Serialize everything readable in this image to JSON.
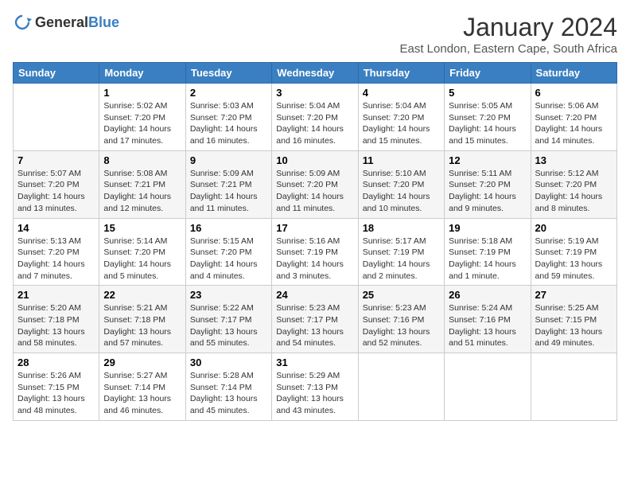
{
  "logo": {
    "general": "General",
    "blue": "Blue"
  },
  "header": {
    "month": "January 2024",
    "location": "East London, Eastern Cape, South Africa"
  },
  "weekdays": [
    "Sunday",
    "Monday",
    "Tuesday",
    "Wednesday",
    "Thursday",
    "Friday",
    "Saturday"
  ],
  "weeks": [
    [
      {
        "day": "",
        "info": ""
      },
      {
        "day": "1",
        "info": "Sunrise: 5:02 AM\nSunset: 7:20 PM\nDaylight: 14 hours\nand 17 minutes."
      },
      {
        "day": "2",
        "info": "Sunrise: 5:03 AM\nSunset: 7:20 PM\nDaylight: 14 hours\nand 16 minutes."
      },
      {
        "day": "3",
        "info": "Sunrise: 5:04 AM\nSunset: 7:20 PM\nDaylight: 14 hours\nand 16 minutes."
      },
      {
        "day": "4",
        "info": "Sunrise: 5:04 AM\nSunset: 7:20 PM\nDaylight: 14 hours\nand 15 minutes."
      },
      {
        "day": "5",
        "info": "Sunrise: 5:05 AM\nSunset: 7:20 PM\nDaylight: 14 hours\nand 15 minutes."
      },
      {
        "day": "6",
        "info": "Sunrise: 5:06 AM\nSunset: 7:20 PM\nDaylight: 14 hours\nand 14 minutes."
      }
    ],
    [
      {
        "day": "7",
        "info": "Sunrise: 5:07 AM\nSunset: 7:20 PM\nDaylight: 14 hours\nand 13 minutes."
      },
      {
        "day": "8",
        "info": "Sunrise: 5:08 AM\nSunset: 7:21 PM\nDaylight: 14 hours\nand 12 minutes."
      },
      {
        "day": "9",
        "info": "Sunrise: 5:09 AM\nSunset: 7:21 PM\nDaylight: 14 hours\nand 11 minutes."
      },
      {
        "day": "10",
        "info": "Sunrise: 5:09 AM\nSunset: 7:20 PM\nDaylight: 14 hours\nand 11 minutes."
      },
      {
        "day": "11",
        "info": "Sunrise: 5:10 AM\nSunset: 7:20 PM\nDaylight: 14 hours\nand 10 minutes."
      },
      {
        "day": "12",
        "info": "Sunrise: 5:11 AM\nSunset: 7:20 PM\nDaylight: 14 hours\nand 9 minutes."
      },
      {
        "day": "13",
        "info": "Sunrise: 5:12 AM\nSunset: 7:20 PM\nDaylight: 14 hours\nand 8 minutes."
      }
    ],
    [
      {
        "day": "14",
        "info": "Sunrise: 5:13 AM\nSunset: 7:20 PM\nDaylight: 14 hours\nand 7 minutes."
      },
      {
        "day": "15",
        "info": "Sunrise: 5:14 AM\nSunset: 7:20 PM\nDaylight: 14 hours\nand 5 minutes."
      },
      {
        "day": "16",
        "info": "Sunrise: 5:15 AM\nSunset: 7:20 PM\nDaylight: 14 hours\nand 4 minutes."
      },
      {
        "day": "17",
        "info": "Sunrise: 5:16 AM\nSunset: 7:19 PM\nDaylight: 14 hours\nand 3 minutes."
      },
      {
        "day": "18",
        "info": "Sunrise: 5:17 AM\nSunset: 7:19 PM\nDaylight: 14 hours\nand 2 minutes."
      },
      {
        "day": "19",
        "info": "Sunrise: 5:18 AM\nSunset: 7:19 PM\nDaylight: 14 hours\nand 1 minute."
      },
      {
        "day": "20",
        "info": "Sunrise: 5:19 AM\nSunset: 7:19 PM\nDaylight: 13 hours\nand 59 minutes."
      }
    ],
    [
      {
        "day": "21",
        "info": "Sunrise: 5:20 AM\nSunset: 7:18 PM\nDaylight: 13 hours\nand 58 minutes."
      },
      {
        "day": "22",
        "info": "Sunrise: 5:21 AM\nSunset: 7:18 PM\nDaylight: 13 hours\nand 57 minutes."
      },
      {
        "day": "23",
        "info": "Sunrise: 5:22 AM\nSunset: 7:17 PM\nDaylight: 13 hours\nand 55 minutes."
      },
      {
        "day": "24",
        "info": "Sunrise: 5:23 AM\nSunset: 7:17 PM\nDaylight: 13 hours\nand 54 minutes."
      },
      {
        "day": "25",
        "info": "Sunrise: 5:23 AM\nSunset: 7:16 PM\nDaylight: 13 hours\nand 52 minutes."
      },
      {
        "day": "26",
        "info": "Sunrise: 5:24 AM\nSunset: 7:16 PM\nDaylight: 13 hours\nand 51 minutes."
      },
      {
        "day": "27",
        "info": "Sunrise: 5:25 AM\nSunset: 7:15 PM\nDaylight: 13 hours\nand 49 minutes."
      }
    ],
    [
      {
        "day": "28",
        "info": "Sunrise: 5:26 AM\nSunset: 7:15 PM\nDaylight: 13 hours\nand 48 minutes."
      },
      {
        "day": "29",
        "info": "Sunrise: 5:27 AM\nSunset: 7:14 PM\nDaylight: 13 hours\nand 46 minutes."
      },
      {
        "day": "30",
        "info": "Sunrise: 5:28 AM\nSunset: 7:14 PM\nDaylight: 13 hours\nand 45 minutes."
      },
      {
        "day": "31",
        "info": "Sunrise: 5:29 AM\nSunset: 7:13 PM\nDaylight: 13 hours\nand 43 minutes."
      },
      {
        "day": "",
        "info": ""
      },
      {
        "day": "",
        "info": ""
      },
      {
        "day": "",
        "info": ""
      }
    ]
  ]
}
